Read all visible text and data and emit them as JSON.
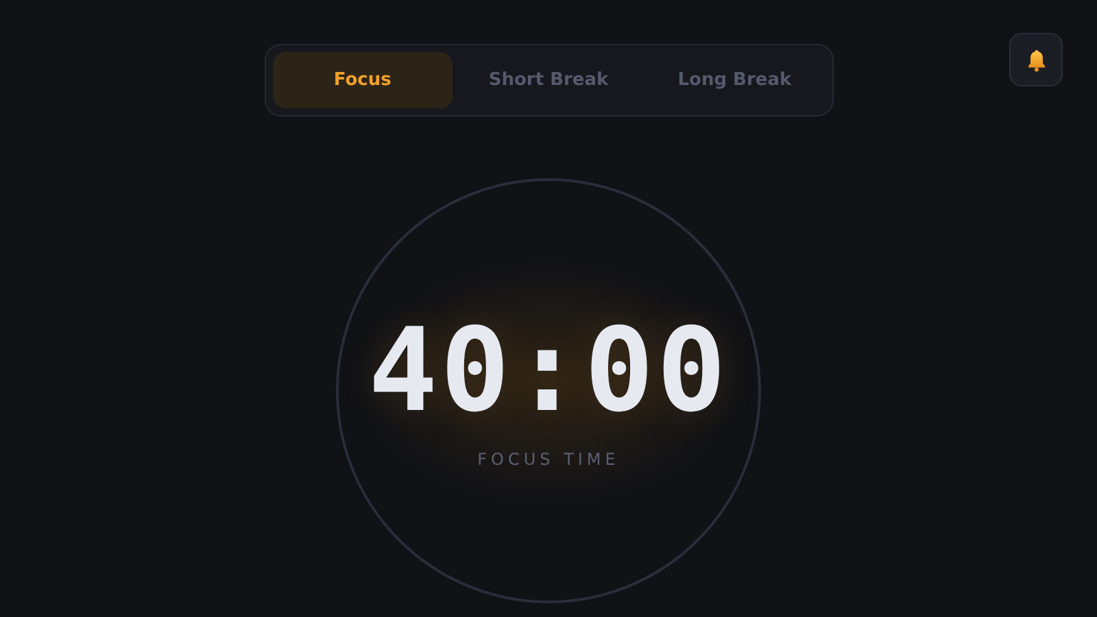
{
  "tabs": [
    {
      "label": "Focus",
      "selected": true
    },
    {
      "label": "Short Break",
      "selected": false
    },
    {
      "label": "Long Break",
      "selected": false
    }
  ],
  "timer": {
    "time": "40:00",
    "caption": "FOCUS TIME"
  }
}
